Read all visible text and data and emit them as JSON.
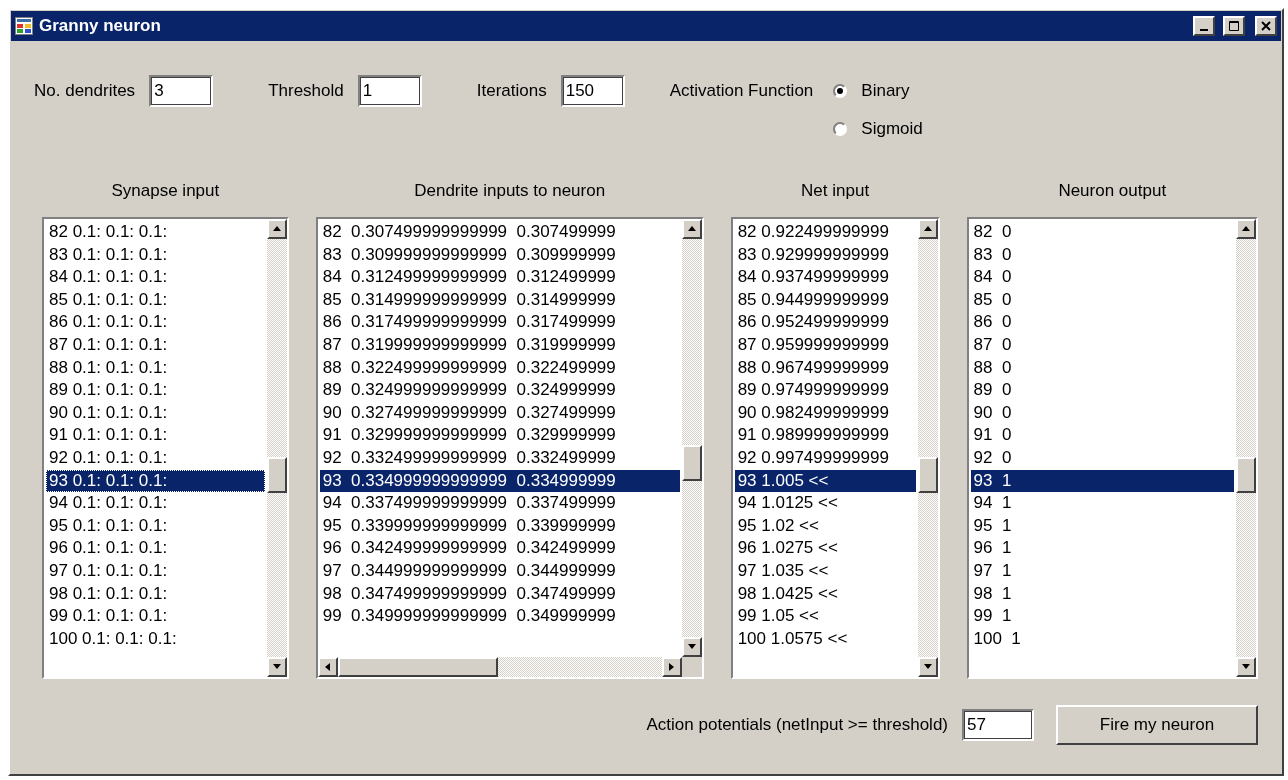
{
  "window": {
    "title": "Granny neuron"
  },
  "fields": [
    {
      "label": "No. dendrites",
      "value": "3"
    },
    {
      "label": "Threshold",
      "value": "1"
    },
    {
      "label": "Iterations",
      "value": "150"
    }
  ],
  "activation": {
    "label": "Activation Function",
    "options": [
      {
        "label": "Binary",
        "selected": true
      },
      {
        "label": "Sigmoid",
        "selected": false
      }
    ]
  },
  "lists": [
    {
      "heading": "Synapse input",
      "kind": "vertical",
      "items": [
        {
          "text": "82 0.1: 0.1: 0.1:",
          "selected": false
        },
        {
          "text": "83 0.1: 0.1: 0.1:",
          "selected": false
        },
        {
          "text": "84 0.1: 0.1: 0.1:",
          "selected": false
        },
        {
          "text": "85 0.1: 0.1: 0.1:",
          "selected": false
        },
        {
          "text": "86 0.1: 0.1: 0.1:",
          "selected": false
        },
        {
          "text": "87 0.1: 0.1: 0.1:",
          "selected": false
        },
        {
          "text": "88 0.1: 0.1: 0.1:",
          "selected": false
        },
        {
          "text": "89 0.1: 0.1: 0.1:",
          "selected": false
        },
        {
          "text": "90 0.1: 0.1: 0.1:",
          "selected": false
        },
        {
          "text": "91 0.1: 0.1: 0.1:",
          "selected": false
        },
        {
          "text": "92 0.1: 0.1: 0.1:",
          "selected": false
        },
        {
          "text": "93 0.1: 0.1: 0.1:",
          "selected": true
        },
        {
          "text": "94 0.1: 0.1: 0.1:",
          "selected": false
        },
        {
          "text": "95 0.1: 0.1: 0.1:",
          "selected": false
        },
        {
          "text": "96 0.1: 0.1: 0.1:",
          "selected": false
        },
        {
          "text": "97 0.1: 0.1: 0.1:",
          "selected": false
        },
        {
          "text": "98 0.1: 0.1: 0.1:",
          "selected": false
        },
        {
          "text": "99 0.1: 0.1: 0.1:",
          "selected": false
        },
        {
          "text": "100 0.1: 0.1: 0.1:",
          "selected": false
        }
      ]
    },
    {
      "heading": "Dendrite inputs to neuron",
      "kind": "both",
      "items": [
        {
          "text": "82  0.307499999999999  0.307499999",
          "selected": false
        },
        {
          "text": "83  0.309999999999999  0.309999999",
          "selected": false
        },
        {
          "text": "84  0.312499999999999  0.312499999",
          "selected": false
        },
        {
          "text": "85  0.314999999999999  0.314999999",
          "selected": false
        },
        {
          "text": "86  0.317499999999999  0.317499999",
          "selected": false
        },
        {
          "text": "87  0.319999999999999  0.319999999",
          "selected": false
        },
        {
          "text": "88  0.322499999999999  0.322499999",
          "selected": false
        },
        {
          "text": "89  0.324999999999999  0.324999999",
          "selected": false
        },
        {
          "text": "90  0.327499999999999  0.327499999",
          "selected": false
        },
        {
          "text": "91  0.329999999999999  0.329999999",
          "selected": false
        },
        {
          "text": "92  0.332499999999999  0.332499999",
          "selected": false
        },
        {
          "text": "93  0.334999999999999  0.334999999",
          "selected": true
        },
        {
          "text": "94  0.337499999999999  0.337499999",
          "selected": false
        },
        {
          "text": "95  0.339999999999999  0.339999999",
          "selected": false
        },
        {
          "text": "96  0.342499999999999  0.342499999",
          "selected": false
        },
        {
          "text": "97  0.344999999999999  0.344999999",
          "selected": false
        },
        {
          "text": "98  0.347499999999999  0.347499999",
          "selected": false
        },
        {
          "text": "99  0.349999999999999  0.349999999",
          "selected": false
        }
      ]
    },
    {
      "heading": "Net input",
      "kind": "vertical",
      "items": [
        {
          "text": "82 0.922499999999",
          "selected": false
        },
        {
          "text": "83 0.929999999999",
          "selected": false
        },
        {
          "text": "84 0.937499999999",
          "selected": false
        },
        {
          "text": "85 0.944999999999",
          "selected": false
        },
        {
          "text": "86 0.952499999999",
          "selected": false
        },
        {
          "text": "87 0.959999999999",
          "selected": false
        },
        {
          "text": "88 0.967499999999",
          "selected": false
        },
        {
          "text": "89 0.974999999999",
          "selected": false
        },
        {
          "text": "90 0.982499999999",
          "selected": false
        },
        {
          "text": "91 0.989999999999",
          "selected": false
        },
        {
          "text": "92 0.997499999999",
          "selected": false
        },
        {
          "text": "93 1.005 <<",
          "selected": true
        },
        {
          "text": "94 1.0125 <<",
          "selected": false
        },
        {
          "text": "95 1.02 <<",
          "selected": false
        },
        {
          "text": "96 1.0275 <<",
          "selected": false
        },
        {
          "text": "97 1.035 <<",
          "selected": false
        },
        {
          "text": "98 1.0425 <<",
          "selected": false
        },
        {
          "text": "99 1.05 <<",
          "selected": false
        },
        {
          "text": "100 1.0575 <<",
          "selected": false
        }
      ]
    },
    {
      "heading": "Neuron output",
      "kind": "vertical",
      "items": [
        {
          "text": "82  0",
          "selected": false
        },
        {
          "text": "83  0",
          "selected": false
        },
        {
          "text": "84  0",
          "selected": false
        },
        {
          "text": "85  0",
          "selected": false
        },
        {
          "text": "86  0",
          "selected": false
        },
        {
          "text": "87  0",
          "selected": false
        },
        {
          "text": "88  0",
          "selected": false
        },
        {
          "text": "89  0",
          "selected": false
        },
        {
          "text": "90  0",
          "selected": false
        },
        {
          "text": "91  0",
          "selected": false
        },
        {
          "text": "92  0",
          "selected": false
        },
        {
          "text": "93  1",
          "selected": true
        },
        {
          "text": "94  1",
          "selected": false
        },
        {
          "text": "95  1",
          "selected": false
        },
        {
          "text": "96  1",
          "selected": false
        },
        {
          "text": "97  1",
          "selected": false
        },
        {
          "text": "98  1",
          "selected": false
        },
        {
          "text": "99  1",
          "selected": false
        },
        {
          "text": "100  1",
          "selected": false
        }
      ]
    }
  ],
  "footer": {
    "label": "Action potentials (netInput >= threshold)",
    "value": "57",
    "button": "Fire my neuron"
  }
}
